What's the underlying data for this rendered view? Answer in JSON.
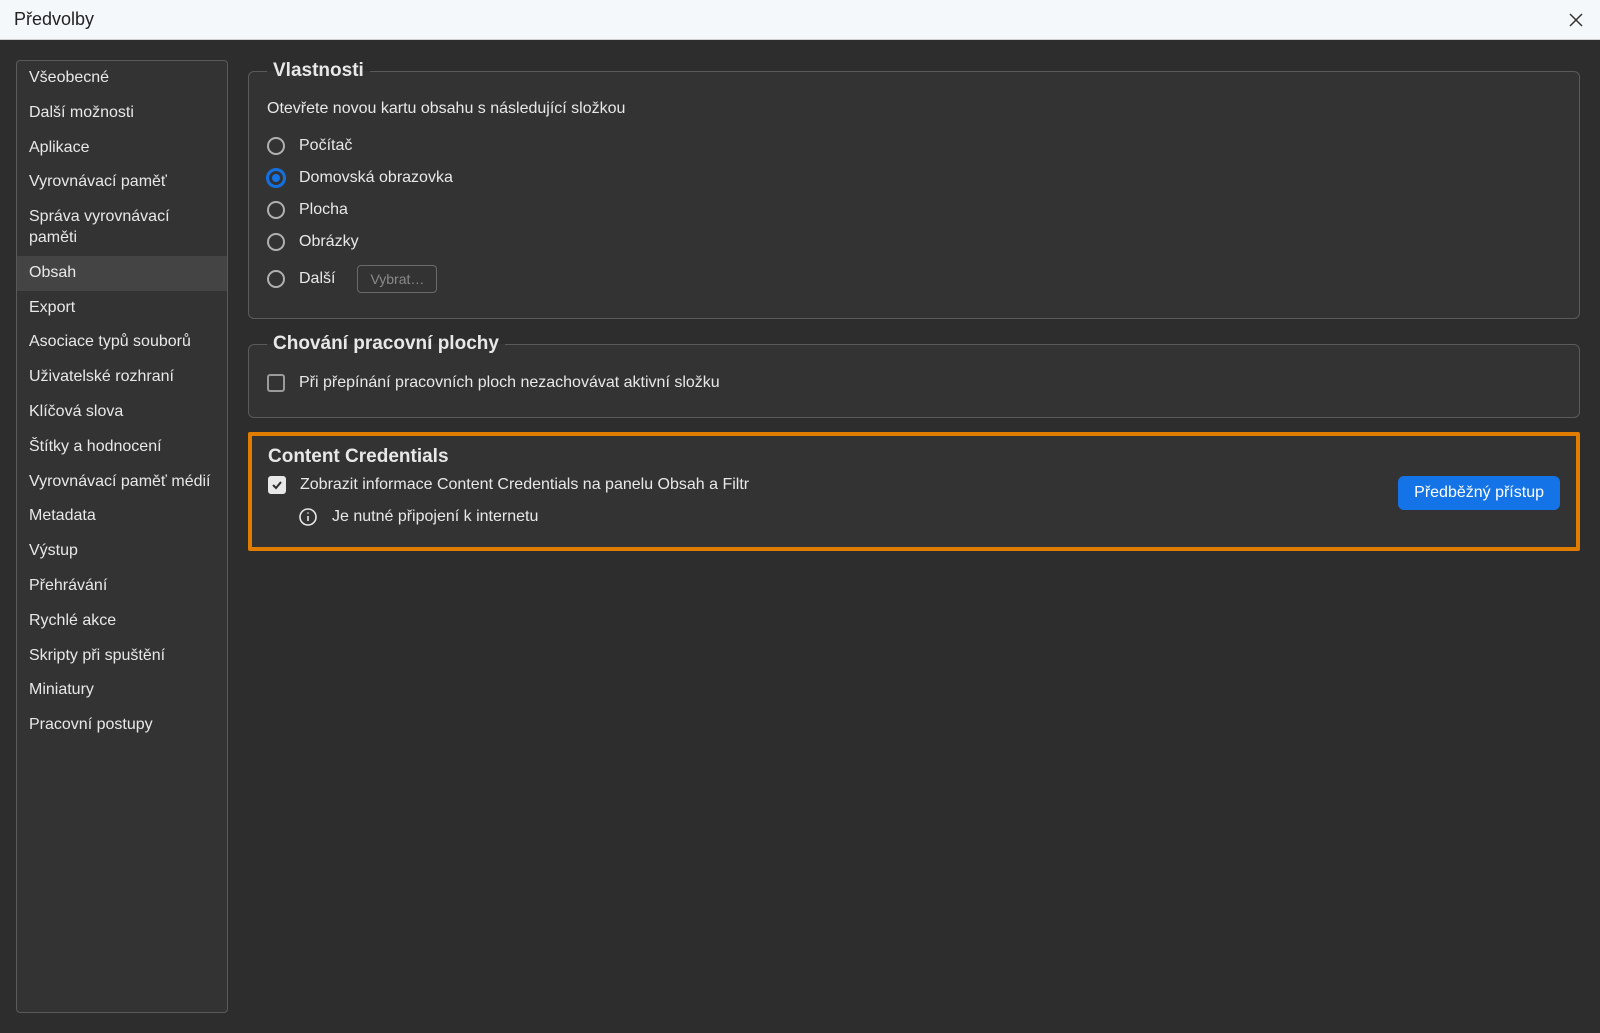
{
  "window": {
    "title": "Předvolby"
  },
  "sidebar": {
    "items": [
      {
        "label": "Všeobecné"
      },
      {
        "label": "Další možnosti"
      },
      {
        "label": "Aplikace"
      },
      {
        "label": "Vyrovnávací paměť"
      },
      {
        "label": "Správa vyrovnávací paměti"
      },
      {
        "label": "Obsah",
        "selected": true
      },
      {
        "label": "Export"
      },
      {
        "label": "Asociace typů souborů"
      },
      {
        "label": "Uživatelské rozhraní"
      },
      {
        "label": "Klíčová slova"
      },
      {
        "label": "Štítky a hodnocení"
      },
      {
        "label": "Vyrovnávací paměť médií"
      },
      {
        "label": "Metadata"
      },
      {
        "label": "Výstup"
      },
      {
        "label": "Přehrávání"
      },
      {
        "label": "Rychlé akce"
      },
      {
        "label": "Skripty při spuštění"
      },
      {
        "label": "Miniatury"
      },
      {
        "label": "Pracovní postupy"
      }
    ]
  },
  "properties": {
    "legend": "Vlastnosti",
    "description": "Otevřete novou kartu obsahu s následující složkou",
    "options": [
      {
        "label": "Počítač",
        "selected": false
      },
      {
        "label": "Domovská obrazovka",
        "selected": true
      },
      {
        "label": "Plocha",
        "selected": false
      },
      {
        "label": "Obrázky",
        "selected": false
      },
      {
        "label": "Další",
        "selected": false,
        "button": "Vybrat…"
      }
    ]
  },
  "workspace_behavior": {
    "legend": "Chování pracovní plochy",
    "checkbox_label": "Při přepínání pracovních ploch nezachovávat aktivní složku",
    "checked": false
  },
  "content_credentials": {
    "legend": "Content Credentials",
    "checkbox_label": "Zobrazit informace Content Credentials na panelu Obsah a Filtr",
    "checked": true,
    "info_text": "Je nutné připojení k internetu",
    "button_label": "Předběžný přístup"
  }
}
